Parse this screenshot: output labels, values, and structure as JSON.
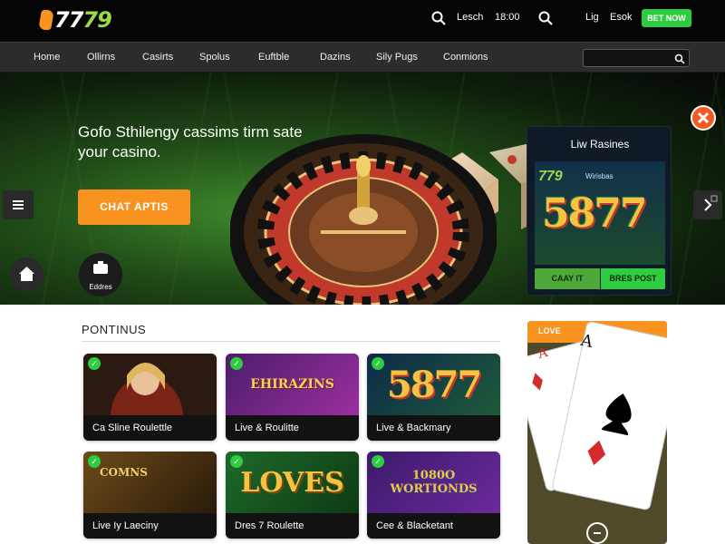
{
  "header": {
    "logo_prefix": "77",
    "logo_suffix": "79",
    "login_label": "Lesch",
    "time_label": "18:00",
    "lang_label": "Lig",
    "enroll_label": "Esok",
    "cta_label": "BET NOW"
  },
  "nav": {
    "items": [
      "Home",
      "Ollirns",
      "Casirts",
      "Spolus",
      "Euftble",
      "Dazins",
      "Sily Pugs",
      "Conmions"
    ],
    "search_placeholder": ""
  },
  "hero": {
    "title": "Gofo Sthilengy cassims tirm sate your casino.",
    "cta_label": "CHAT APTIS",
    "editors_label": "Eddres"
  },
  "live_panel": {
    "title": "Liw Rasines",
    "logo": "779",
    "subtitle": "Wirisbas",
    "banner_number": "5877",
    "play_button": "CAAY IT",
    "bonus_button": "BRES POST"
  },
  "section": {
    "title": "PONTINUS"
  },
  "cards": [
    {
      "label": "Ca Sline Roulettle",
      "art": ""
    },
    {
      "label": "Live & Roulitte",
      "art": "EHIRAZINS"
    },
    {
      "label": "Live & Backmary",
      "art": "5877"
    },
    {
      "label": "Live Iy Laeciny",
      "art": "COMNS"
    },
    {
      "label": "Dres 7 Roulette",
      "art": "LOVES"
    },
    {
      "label": "Cee & Blacketant",
      "art": "1080O WORTIONDS"
    }
  ],
  "promo": {
    "badge": "LOVE",
    "card_rank": "A"
  },
  "colors": {
    "accent_orange": "#f7931e",
    "accent_green": "#2ecc40",
    "nav_bg": "#2c2c2c"
  },
  "icons": [
    "search-icon",
    "menu-icon",
    "chevron-right-icon",
    "home-icon",
    "editors-icon",
    "close-icon",
    "play-icon",
    "check-icon"
  ]
}
